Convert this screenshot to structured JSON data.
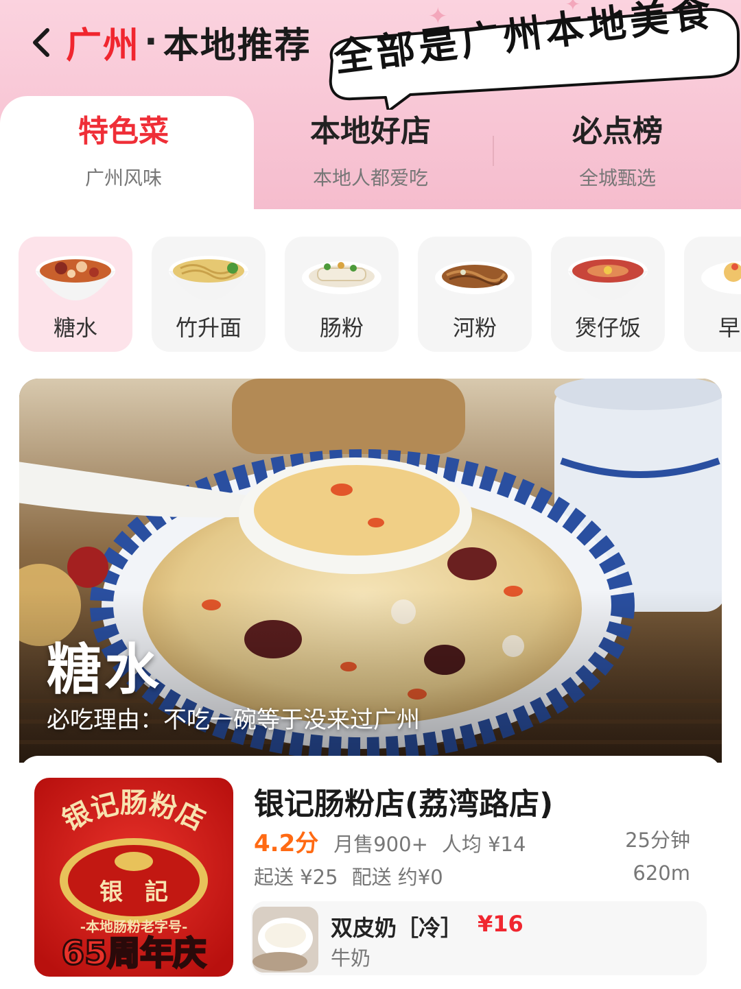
{
  "header": {
    "title_city": "广州",
    "title_dot": "·",
    "title_rest": "本地推荐",
    "bubble_text": "全部是广州本地美食"
  },
  "tabs": [
    {
      "title": "特色菜",
      "subtitle": "广州风味",
      "active": true
    },
    {
      "title": "本地好店",
      "subtitle": "本地人都爱吃",
      "active": false
    },
    {
      "title": "必点榜",
      "subtitle": "全城甄选",
      "active": false
    }
  ],
  "categories": [
    {
      "label": "糖水",
      "active": true
    },
    {
      "label": "竹升面",
      "active": false
    },
    {
      "label": "肠粉",
      "active": false
    },
    {
      "label": "河粉",
      "active": false
    },
    {
      "label": "煲仔饭",
      "active": false
    },
    {
      "label": "早",
      "active": false
    }
  ],
  "hero": {
    "title": "糖水",
    "reason": "必吃理由：不吃一碗等于没来过广州"
  },
  "shop": {
    "name": "银记肠粉店(荔湾路店)",
    "rating": "4.2分",
    "monthly_sales": "月售900+",
    "avg_price": "人均 ¥14",
    "delivery_time": "25分钟",
    "min_order": "起送 ¥25",
    "delivery_fee": "配送 约¥0",
    "distance": "620m",
    "logo_text": {
      "arc": "银记肠粉店",
      "center_1": "银",
      "center_2": "記",
      "tagline": "-本地肠粉老字号-",
      "anniversary": "65周年庆"
    },
    "dish": {
      "name": "双皮奶［冷］",
      "price": "¥16",
      "sub": "牛奶"
    }
  },
  "colors": {
    "accent_red": "#f0262f",
    "rating_orange": "#ff6a13",
    "header_pink": "#f8c6d5"
  }
}
